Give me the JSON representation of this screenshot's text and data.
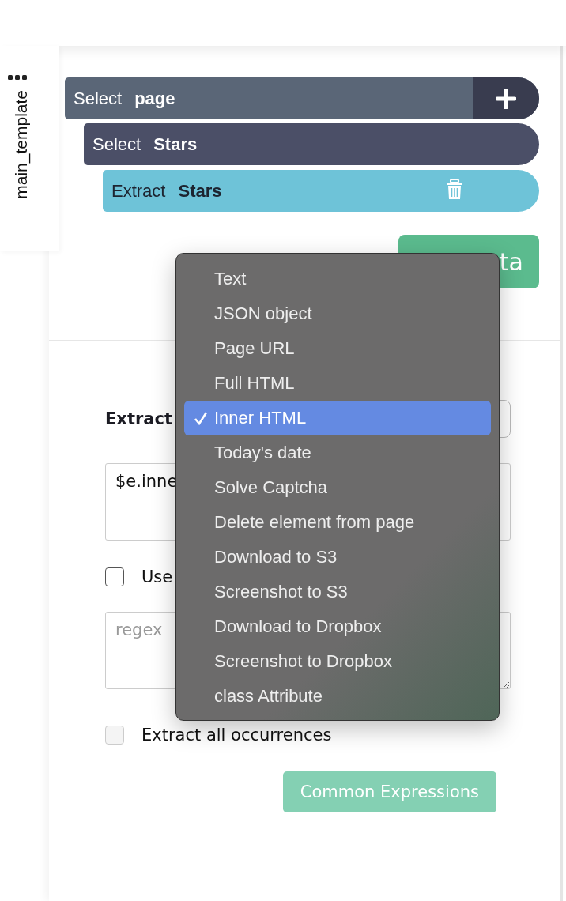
{
  "side_tab": {
    "label": "main_template"
  },
  "steps": [
    {
      "kind": "select",
      "action": "Select",
      "target": "page"
    },
    {
      "kind": "select",
      "action": "Select",
      "target": "Stars"
    },
    {
      "kind": "extract",
      "action": "Extract",
      "target": "Stars"
    }
  ],
  "get_data_button": {
    "label": "ta"
  },
  "extract_field": {
    "label": "Extract"
  },
  "expression_field": {
    "value": "$e.inne"
  },
  "regex_checkbox": {
    "label": "Use",
    "checked": false,
    "disabled": false
  },
  "regex_field": {
    "placeholder": "regex"
  },
  "all_occurrences_checkbox": {
    "label": "Extract all occurrences",
    "checked": false,
    "disabled": true
  },
  "common_expressions_button": {
    "label": "Common Expressions"
  },
  "dropdown_menu": {
    "items": [
      {
        "label": "Text",
        "selected": false
      },
      {
        "label": "JSON object",
        "selected": false
      },
      {
        "label": "Page URL",
        "selected": false
      },
      {
        "label": "Full HTML",
        "selected": false
      },
      {
        "label": "Inner HTML",
        "selected": true
      },
      {
        "label": "Today's date",
        "selected": false
      },
      {
        "label": "Solve Captcha",
        "selected": false
      },
      {
        "label": "Delete element from page",
        "selected": false
      },
      {
        "label": "Download to S3",
        "selected": false
      },
      {
        "label": "Screenshot to S3",
        "selected": false
      },
      {
        "label": "Download to Dropbox",
        "selected": false
      },
      {
        "label": "Screenshot to Dropbox",
        "selected": false
      },
      {
        "label": "class Attribute",
        "selected": false
      }
    ]
  }
}
